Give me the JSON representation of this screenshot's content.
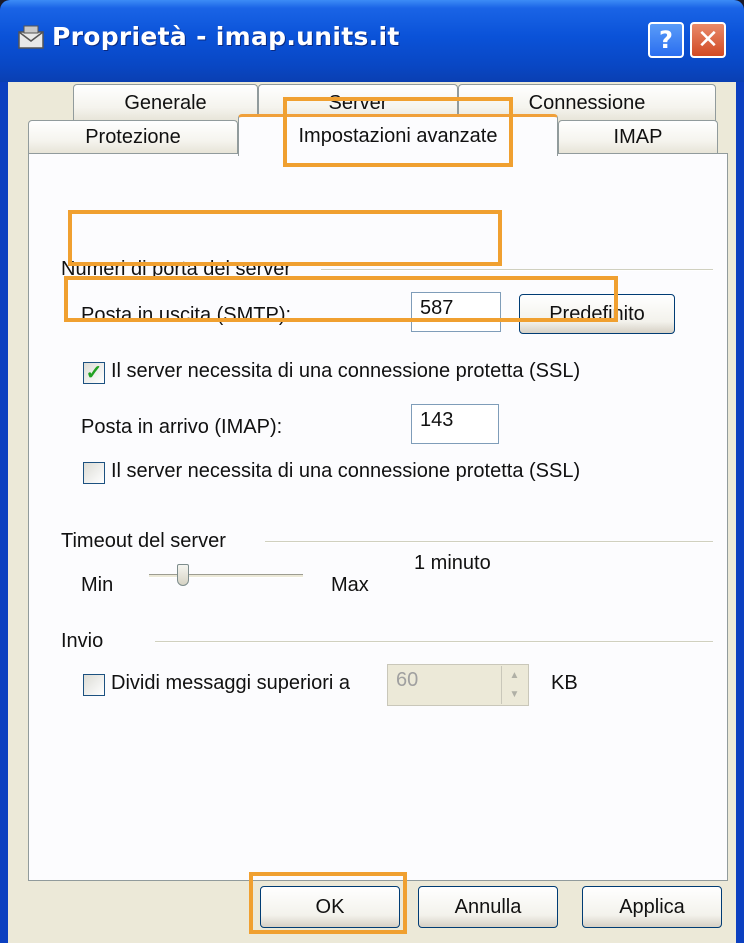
{
  "window": {
    "title": "Proprietà - imap.units.it"
  },
  "tabs": {
    "row_back": [
      "Generale",
      "Server",
      "Connessione"
    ],
    "row_front": [
      "Protezione",
      "Impostazioni avanzate",
      "IMAP"
    ],
    "active": "Impostazioni avanzate"
  },
  "ports": {
    "group_label": "Numeri di porta del server",
    "smtp_label": "Posta in uscita (SMTP):",
    "smtp_value": "587",
    "default_button": "Predefinito",
    "smtp_ssl_label": "Il server necessita di una connessione protetta (SSL)",
    "smtp_ssl_checked": true,
    "imap_label": "Posta in arrivo (IMAP):",
    "imap_value": "143",
    "imap_ssl_label": "Il server necessita di una connessione protetta (SSL)",
    "imap_ssl_checked": false
  },
  "timeout": {
    "group_label": "Timeout del server",
    "min_label": "Min",
    "max_label": "Max",
    "value_text": "1 minuto",
    "level": 0.2
  },
  "invio": {
    "group_label": "Invio",
    "split_label": "Dividi messaggi superiori a",
    "split_checked": false,
    "split_value": "60",
    "unit": "KB"
  },
  "buttons": {
    "ok": "OK",
    "cancel": "Annulla",
    "apply": "Applica"
  },
  "colors": {
    "highlight": "#f0a030",
    "titlebar": "#0a52d8",
    "checkmark": "#21a121"
  }
}
